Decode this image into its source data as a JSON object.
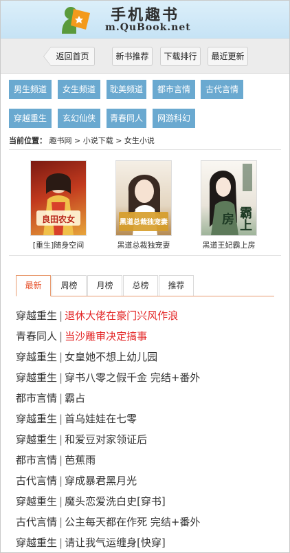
{
  "header": {
    "title": "手机趣书",
    "domain": "m.QuBook.net",
    "colors": {
      "green": "#5a9a3c",
      "orange": "#f39a1c"
    }
  },
  "topnav": [
    {
      "label": "返回首页"
    },
    {
      "label": "新书推荐"
    },
    {
      "label": "下载排行"
    },
    {
      "label": "最近更新"
    }
  ],
  "categories": [
    "男生频道",
    "女生频道",
    "耽美频道",
    "都市言情",
    "古代言情",
    "穿越重生",
    "玄幻仙侠",
    "青春同人",
    "网游科幻"
  ],
  "breadcrumb": {
    "label": "当前位置：",
    "path": "趣书网 > 小说下载 > 女生小说"
  },
  "books": [
    {
      "title": "[重生]随身空间",
      "cover_text": "良田农女",
      "cover_colors": [
        "#c23a1e",
        "#e7a53b"
      ]
    },
    {
      "title": "黑道总裁独宠妻",
      "cover_text": "黑道总裁独宠妻",
      "cover_colors": [
        "#efe6da",
        "#b58a52"
      ]
    },
    {
      "title": "黑道王妃霸上房",
      "cover_text": "霸上房",
      "cover_colors": [
        "#f3efe9",
        "#38523a"
      ]
    }
  ],
  "tabs": [
    {
      "label": "最新",
      "active": true
    },
    {
      "label": "周榜",
      "active": false
    },
    {
      "label": "月榜",
      "active": false
    },
    {
      "label": "总榜",
      "active": false
    },
    {
      "label": "推荐",
      "active": false
    }
  ],
  "list": [
    {
      "category": "穿越重生",
      "title": "退休大佬在豪门兴风作浪",
      "highlight": true
    },
    {
      "category": "青春同人",
      "title": "当沙雕审决定搞事",
      "highlight": true
    },
    {
      "category": "穿越重生",
      "title": "女皇她不想上幼儿园",
      "highlight": false
    },
    {
      "category": "穿越重生",
      "title": "穿书八零之假千金 完结+番外",
      "highlight": false
    },
    {
      "category": "都市言情",
      "title": "霸占",
      "highlight": false
    },
    {
      "category": "穿越重生",
      "title": "首乌娃娃在七零",
      "highlight": false
    },
    {
      "category": "穿越重生",
      "title": "和爱豆对家领证后",
      "highlight": false
    },
    {
      "category": "都市言情",
      "title": "芭蕉雨",
      "highlight": false
    },
    {
      "category": "古代言情",
      "title": "穿成暴君黑月光",
      "highlight": false
    },
    {
      "category": "穿越重生",
      "title": "魔头恋爱洗白史[穿书]",
      "highlight": false
    },
    {
      "category": "古代言情",
      "title": "公主每天都在作死 完结+番外",
      "highlight": false
    },
    {
      "category": "穿越重生",
      "title": "请让我气运缠身[快穿]",
      "highlight": false
    }
  ],
  "separator": "|"
}
